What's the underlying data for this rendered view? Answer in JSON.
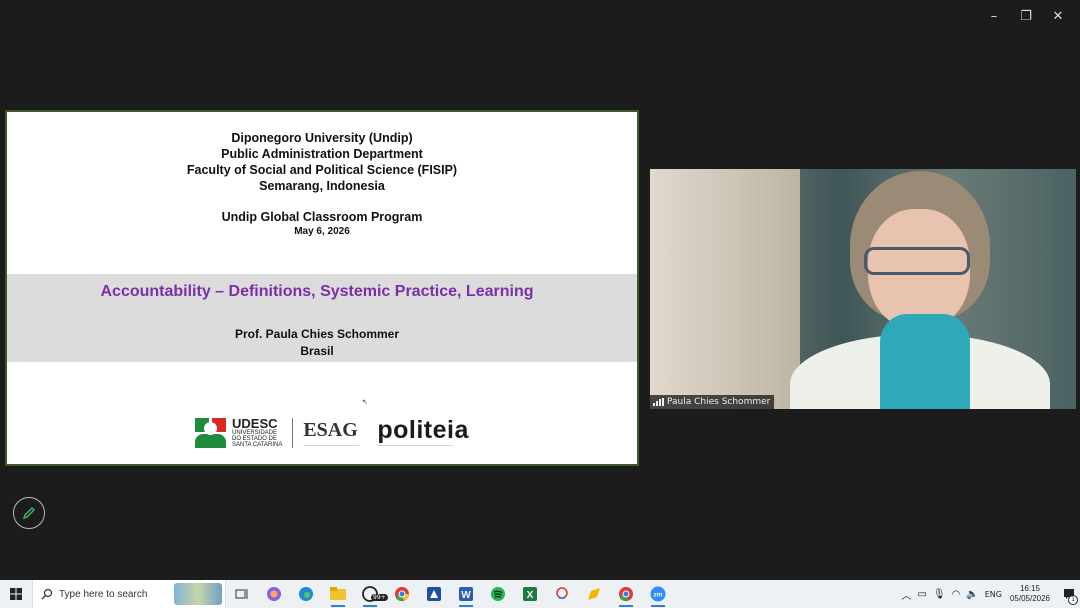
{
  "window_controls": {
    "minimize": "–",
    "restore": "❐",
    "close": "✕"
  },
  "slide": {
    "header_lines": [
      "Diponegoro University (Undip)",
      "Public Administration Department",
      "Faculty of Social and Political Science (FISIP)",
      "Semarang, Indonesia"
    ],
    "program": "Undip Global Classroom Program",
    "date": "May 6, 2026",
    "title": "Accountability – Definitions, Systemic Practice, Learning",
    "author": "Prof. Paula Chies Schommer",
    "country": "Brasil",
    "logos": {
      "udesc_name": "UDESC",
      "udesc_sub": [
        "UNIVERSIDADE",
        "DO ESTADO DE",
        "SANTA CATARINA"
      ],
      "esag": "ESAG",
      "politeia": "politeia"
    }
  },
  "video": {
    "participant_name": "Paula Chies Schommer"
  },
  "taskbar": {
    "search_placeholder": "Type here to search",
    "whatsapp_badge": "99+",
    "tray_lang": "ENG",
    "time": "16:15",
    "date": "05/05/2026",
    "notification_count": "1"
  },
  "colors": {
    "title_purple": "#7b2fa8",
    "slide_border": "#3f5a2a",
    "band_gray": "#dcdcdc"
  }
}
